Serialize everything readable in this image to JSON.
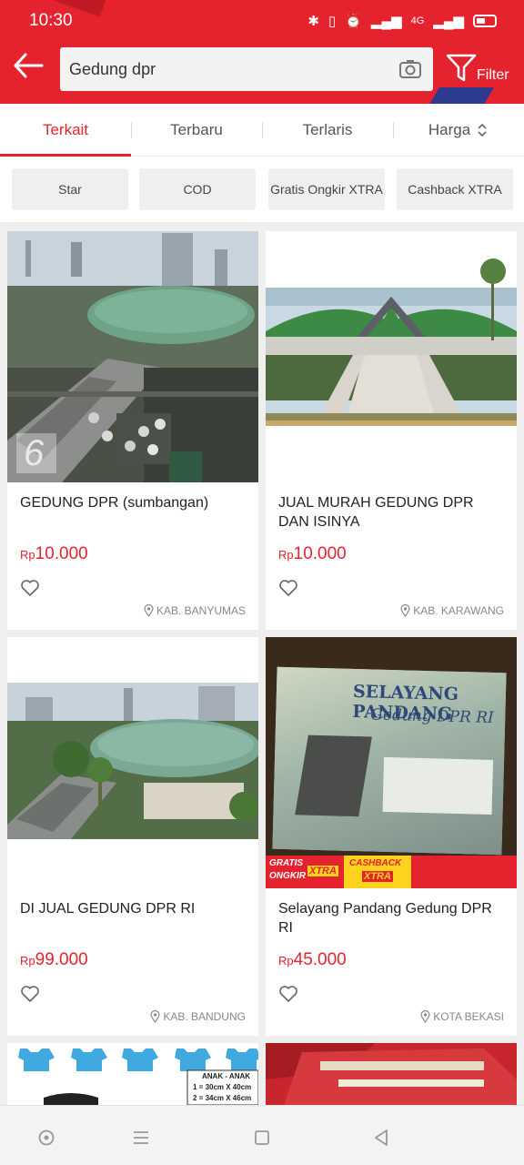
{
  "status": {
    "time": "10:30",
    "network_label": "4G"
  },
  "header": {
    "search_value": "Gedung dpr",
    "filter_label": "Filter"
  },
  "tabs": [
    {
      "label": "Terkait",
      "active": true
    },
    {
      "label": "Terbaru",
      "active": false
    },
    {
      "label": "Terlaris",
      "active": false
    },
    {
      "label": "Harga",
      "active": false
    }
  ],
  "chips": [
    {
      "label": "Star"
    },
    {
      "label": "COD"
    },
    {
      "label": "Gratis Ongkir XTRA"
    },
    {
      "label": "Cashback XTRA"
    }
  ],
  "products": [
    {
      "title": "GEDUNG DPR (sumbangan)",
      "currency": "Rp",
      "price": "10.000",
      "location": "KAB. BANYUMAS",
      "watermark": "6"
    },
    {
      "title": "JUAL MURAH GEDUNG DPR DAN ISINYA",
      "currency": "Rp",
      "price": "10.000",
      "location": "KAB. KARAWANG"
    },
    {
      "title": "DI JUAL GEDUNG DPR RI",
      "currency": "Rp",
      "price": "99.000",
      "location": "KAB. BANDUNG"
    },
    {
      "title": "Selayang Pandang Gedung DPR RI",
      "currency": "Rp",
      "price": "45.000",
      "location": "KOTA BEKASI",
      "book_title": "SELAYANG PANDANG",
      "book_subtitle": "Gedung DPR RI",
      "badge1_a": "GRATIS",
      "badge1_b": "ONGKIR",
      "badge1_c": "XTRA",
      "badge2_a": "CASHBACK",
      "badge2_b": "XTRA"
    }
  ],
  "partial_card": {
    "size_title": "ANAK - ANAK",
    "size_line1": "1 = 30cm X 40cm",
    "size_line2": "2 = 34cm X 46cm"
  },
  "colors": {
    "brand": "#e5232e",
    "accent_blue": "#2c3a8f",
    "price": "#e5232e"
  }
}
